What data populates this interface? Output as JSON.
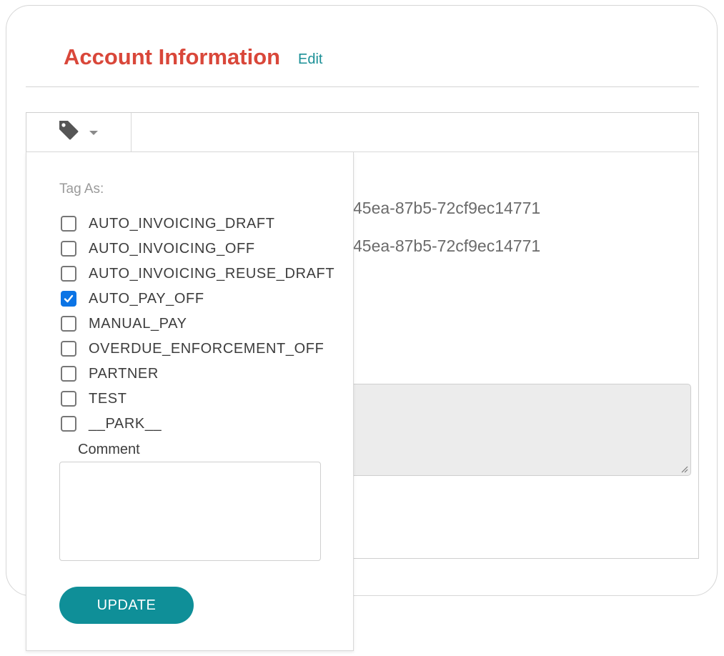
{
  "header": {
    "title": "Account Information",
    "edit_label": "Edit",
    "title_color": "#d9473a",
    "link_color": "#1a8f96"
  },
  "toolbar": {
    "tag_icon": "tag-icon",
    "dropdown_icon": "caret-down-icon"
  },
  "background": {
    "id_line_1": "45ea-87b5-72cf9ec14771",
    "id_line_2": "45ea-87b5-72cf9ec14771"
  },
  "tag_menu": {
    "heading": "Tag As:",
    "tags": [
      {
        "label": "AUTO_INVOICING_DRAFT",
        "checked": false
      },
      {
        "label": "AUTO_INVOICING_OFF",
        "checked": false
      },
      {
        "label": "AUTO_INVOICING_REUSE_DRAFT",
        "checked": false
      },
      {
        "label": "AUTO_PAY_OFF",
        "checked": true
      },
      {
        "label": "MANUAL_PAY",
        "checked": false
      },
      {
        "label": "OVERDUE_ENFORCEMENT_OFF",
        "checked": false
      },
      {
        "label": "PARTNER",
        "checked": false
      },
      {
        "label": "TEST",
        "checked": false
      },
      {
        "label": "__PARK__",
        "checked": false
      }
    ],
    "comment_label": "Comment",
    "comment_value": "",
    "update_label": "UPDATE",
    "accent_color": "#0f8f98",
    "checkbox_color": "#0b74e5"
  }
}
